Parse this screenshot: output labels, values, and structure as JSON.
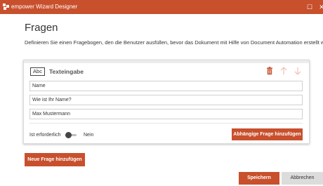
{
  "window": {
    "title": "empower Wizard Designer",
    "maximize_glyph": "☐",
    "close_glyph": "✕"
  },
  "page": {
    "heading": "Fragen",
    "description": "Definieren Sie einen Fragebogen, den die Benutzer ausfüllen, bevor das Dokument mit Hilfe von Document Automation erstellt wird."
  },
  "question": {
    "type_icon_text": "Abc",
    "type_label": "Texteingabe",
    "fields": {
      "name_value": "Name",
      "question_value": "Wie ist Ihr Name?",
      "default_value": "Max Mustermann"
    },
    "required_label": "Ist erforderlich",
    "required_state": "Nein",
    "dependent_button": "Abhängige Frage hinzufügen"
  },
  "actions": {
    "new_question": "Neue Frage hinzufügen",
    "save": "Speichern",
    "cancel": "Abbrechen"
  },
  "colors": {
    "accent": "#c8502d",
    "cancel_bg": "#dcdcdc",
    "arrow_disabled": "#f0c4b6"
  }
}
